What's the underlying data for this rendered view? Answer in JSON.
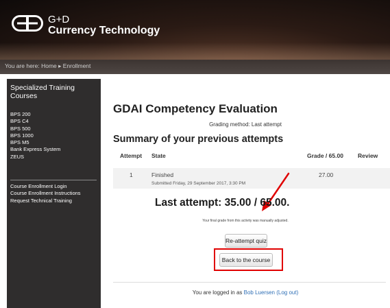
{
  "header": {
    "brand_line1": "G+D",
    "brand_line2": "Currency Technology",
    "breadcrumb": "You are here: Home ▸ Enrollment"
  },
  "sidebar": {
    "title": "Specialized Training Courses",
    "courses": [
      "BPS 200",
      "BPS C4",
      "BPS 500",
      "BPS 1000",
      "BPS M5",
      "Bank Express System",
      "ZEUS"
    ],
    "links": [
      "Course Enrollment Login",
      "Course Enrollment Instructions",
      "Request Technical Training"
    ]
  },
  "main": {
    "title": "GDAI Competency Evaluation",
    "grading_method": "Grading method: Last attempt",
    "summary_title": "Summary of your previous attempts",
    "table": {
      "headers": [
        "Attempt",
        "State",
        "Grade / 65.00",
        "Review"
      ],
      "rows": [
        {
          "attempt": "1",
          "state": "Finished",
          "submitted": "Submitted Friday, 29 September 2017, 3:30 PM",
          "grade": "27.00",
          "review": ""
        }
      ]
    },
    "last_attempt": "Last attempt: 35.00 / 65.00.",
    "adjusted_note": "Your final grade from this activity was manually adjusted.",
    "reattempt_label": "Re-attempt quiz",
    "back_label": "Back to the course"
  },
  "footer": {
    "prefix": "You are logged in as ",
    "user": "Bob Luersen",
    "logout": "(Log out)"
  },
  "colors": {
    "annotation": "#e00000",
    "link": "#2f6fb5",
    "sidebar_bg": "#2f2d2d"
  }
}
